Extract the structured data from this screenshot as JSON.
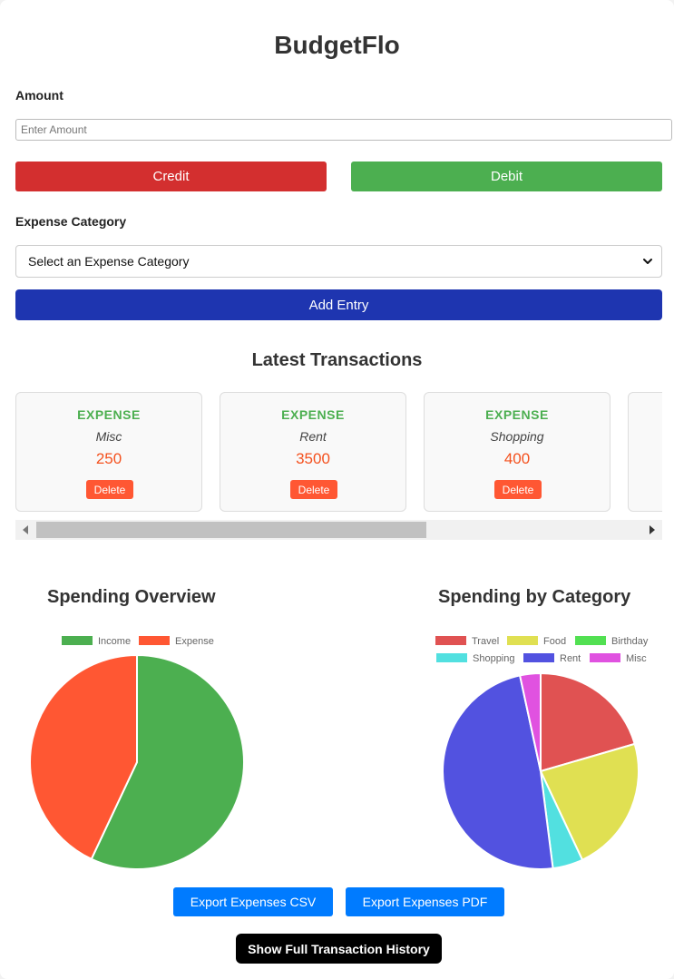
{
  "app": {
    "title": "BudgetFlo"
  },
  "form": {
    "amount_label": "Amount",
    "amount_placeholder": "Enter Amount",
    "amount_value": "",
    "credit_label": "Credit",
    "debit_label": "Debit",
    "category_label": "Expense Category",
    "category_selected": "Select an Expense Category",
    "add_label": "Add Entry"
  },
  "transactions": {
    "title": "Latest Transactions",
    "delete_label": "Delete",
    "items": [
      {
        "type": "EXPENSE",
        "category": "Misc",
        "amount": "250"
      },
      {
        "type": "EXPENSE",
        "category": "Rent",
        "amount": "3500"
      },
      {
        "type": "EXPENSE",
        "category": "Shopping",
        "amount": "400"
      },
      {
        "type": "",
        "category": "",
        "amount": ""
      }
    ]
  },
  "charts": {
    "overview_title": "Spending Overview",
    "category_title": "Spending by Category"
  },
  "chart_data": [
    {
      "type": "pie",
      "title": "Spending Overview",
      "legend_position": "top",
      "categories": [
        "Income",
        "Expense"
      ],
      "values": [
        57,
        43
      ],
      "colors": [
        "#4caf50",
        "#ff5733"
      ]
    },
    {
      "type": "pie",
      "title": "Spending by Category",
      "legend_position": "top",
      "categories": [
        "Travel",
        "Food",
        "Birthday",
        "Shopping",
        "Rent",
        "Misc"
      ],
      "values": [
        20.5,
        22.5,
        0,
        5.0,
        48.6,
        3.4
      ],
      "colors": [
        "#e05252",
        "#e0e052",
        "#52e052",
        "#52e0e0",
        "#5252e0",
        "#e052e0"
      ]
    }
  ],
  "actions": {
    "export_csv": "Export Expenses CSV",
    "export_pdf": "Export Expenses PDF",
    "show_history": "Show Full Transaction History"
  }
}
